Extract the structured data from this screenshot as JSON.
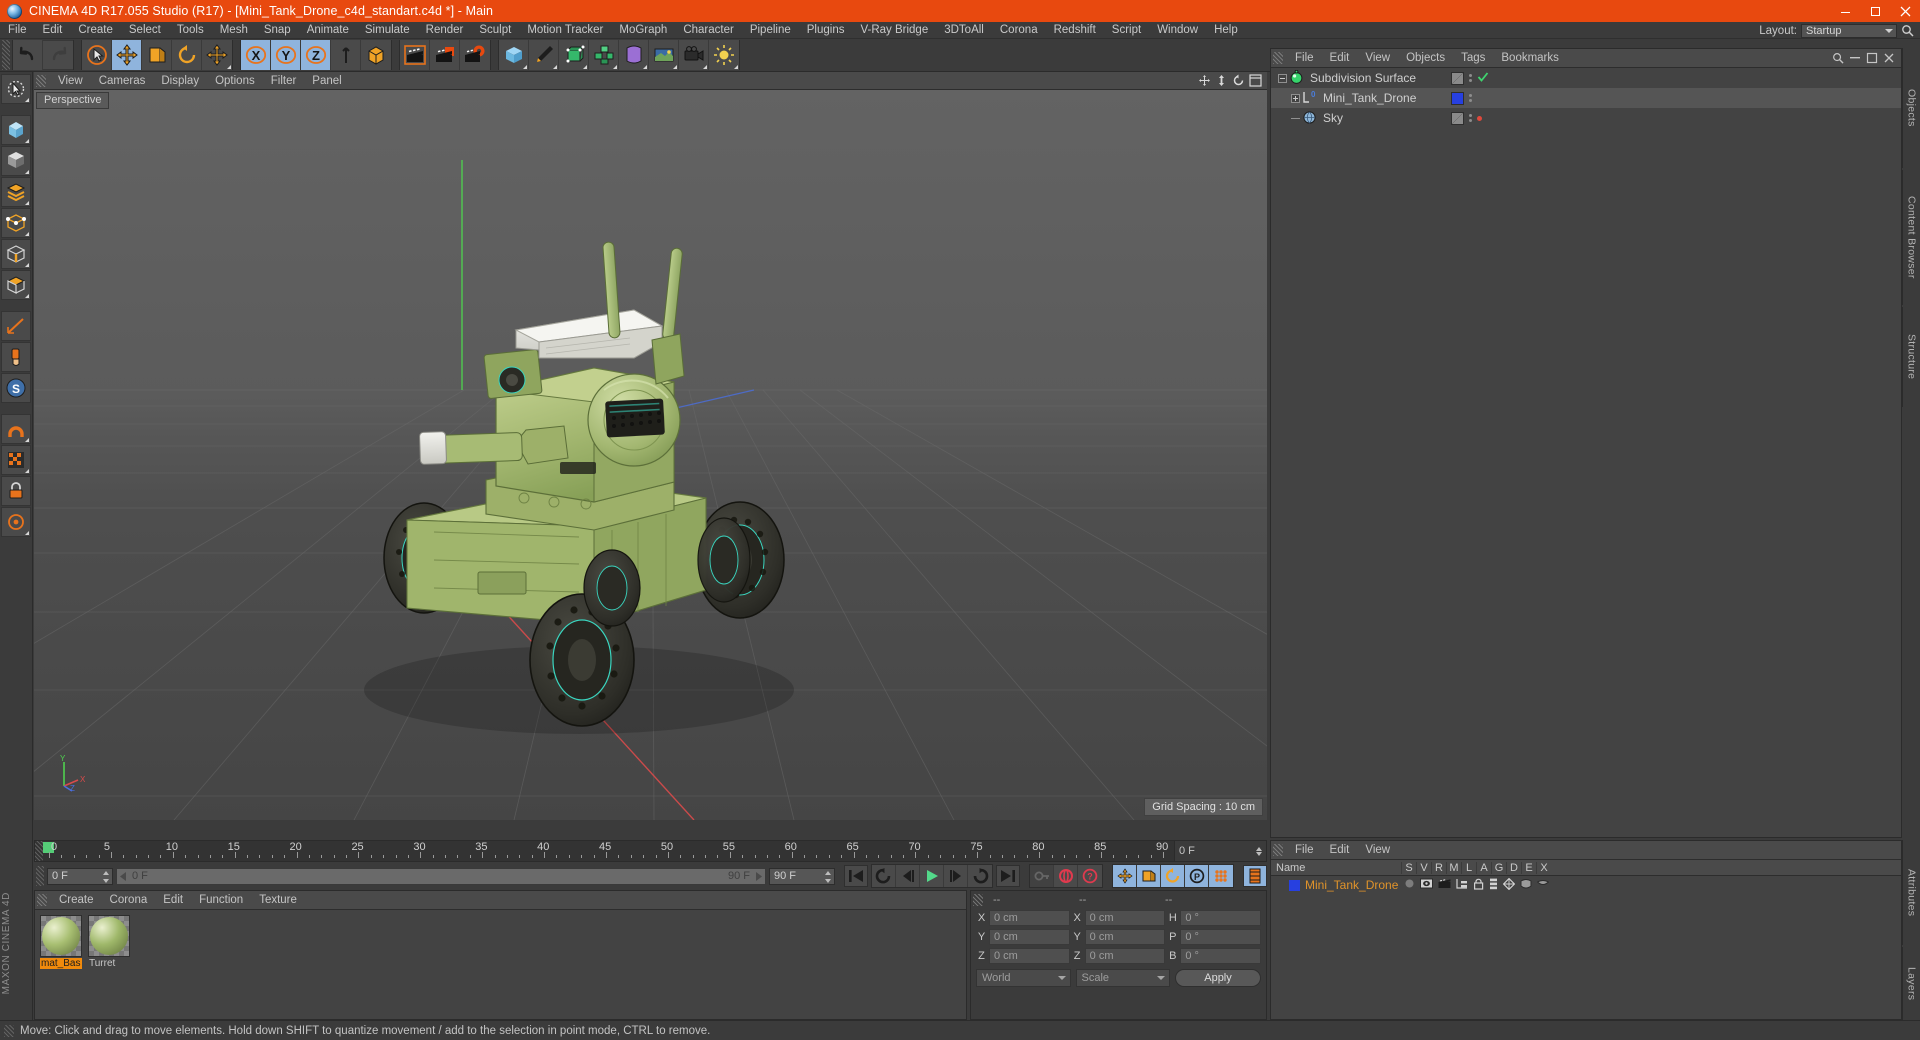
{
  "window": {
    "title": "CINEMA 4D R17.055 Studio (R17) - [Mini_Tank_Drone_c4d_standart.c4d *] - Main",
    "app_icon": "c4d-logo-icon",
    "minimize": "–",
    "maximize": "☐",
    "close": "✕",
    "titlebar_color": "#e8490f"
  },
  "menubar": {
    "items": [
      "File",
      "Edit",
      "Create",
      "Select",
      "Tools",
      "Mesh",
      "Snap",
      "Animate",
      "Simulate",
      "Render",
      "Sculpt",
      "Motion Tracker",
      "MoGraph",
      "Character",
      "Pipeline",
      "Plugins",
      "V-Ray Bridge",
      "3DToAll",
      "Corona",
      "Redshift",
      "Script",
      "Window",
      "Help"
    ],
    "layout_label": "Layout:",
    "layout_value": "Startup",
    "search_icon": "search-icon"
  },
  "toolbar": {
    "groups": [
      {
        "name": "history",
        "buttons": [
          {
            "icon": "undo-icon",
            "state": "normal"
          },
          {
            "icon": "redo-icon",
            "state": "disabled"
          }
        ]
      },
      {
        "name": "transform",
        "buttons": [
          {
            "icon": "select-cursor-icon",
            "state": "normal"
          },
          {
            "icon": "move-tool-icon",
            "state": "active"
          },
          {
            "icon": "scale-tool-icon",
            "state": "normal"
          },
          {
            "icon": "rotate-tool-icon",
            "state": "normal"
          },
          {
            "icon": "move-alt-icon",
            "state": "normal"
          }
        ]
      },
      {
        "name": "axis-locks",
        "buttons": [
          {
            "icon": "axis-x-icon",
            "state": "active"
          },
          {
            "icon": "axis-y-icon",
            "state": "active"
          },
          {
            "icon": "axis-z-icon",
            "state": "active"
          },
          {
            "icon": "world-axis-icon",
            "state": "normal"
          },
          {
            "icon": "object-axis-icon",
            "state": "normal"
          }
        ]
      },
      {
        "name": "render",
        "buttons": [
          {
            "icon": "render-view-icon",
            "state": "normal"
          },
          {
            "icon": "render-to-picture-icon",
            "state": "normal"
          },
          {
            "icon": "render-settings-icon",
            "state": "normal"
          }
        ]
      },
      {
        "name": "create",
        "buttons": [
          {
            "icon": "cube-primitive-icon",
            "state": "normal"
          },
          {
            "icon": "spline-pen-icon",
            "state": "normal"
          },
          {
            "icon": "generator-nurbs-icon",
            "state": "normal"
          },
          {
            "icon": "array-icon",
            "state": "normal"
          },
          {
            "icon": "deformer-icon",
            "state": "normal"
          },
          {
            "icon": "scene-environment-icon",
            "state": "normal"
          },
          {
            "icon": "camera-icon",
            "state": "normal"
          },
          {
            "icon": "light-icon",
            "state": "normal"
          }
        ]
      }
    ]
  },
  "left_palette": {
    "buttons": [
      {
        "icon": "live-selection-icon"
      },
      {
        "icon": "box-model-icon"
      },
      {
        "icon": "polygon-checker-icon"
      },
      {
        "icon": "layers-stack-icon"
      },
      {
        "icon": "points-mode-icon"
      },
      {
        "icon": "edges-mode-icon"
      },
      {
        "icon": "polygons-mode-icon"
      },
      {
        "icon": "measure-icon"
      },
      {
        "icon": "paint-brush-icon"
      },
      {
        "icon": "script-s-icon"
      },
      {
        "icon": "magnet-icon"
      },
      {
        "icon": "texture-grid-icon"
      },
      {
        "icon": "lock-icon"
      },
      {
        "icon": "snap-target-icon"
      }
    ],
    "brand": "MAXON\nCINEMA 4D"
  },
  "viewport": {
    "menu_items": [
      "View",
      "Cameras",
      "Display",
      "Options",
      "Filter",
      "Panel"
    ],
    "view_label": "Perspective",
    "grid_spacing": "Grid Spacing : 10 cm",
    "nav_icons": [
      "pan-icon",
      "dolly-icon",
      "rotate-view-icon",
      "maximize-view-icon"
    ],
    "axis_labels": [
      "Y",
      "Z",
      "X"
    ],
    "model": "mini-tank-drone-3d-model"
  },
  "object_manager": {
    "menu_items": [
      "File",
      "Edit",
      "View",
      "Objects",
      "Tags",
      "Bookmarks"
    ],
    "rows": [
      {
        "name": "Subdivision Surface",
        "icon": "subdivision-surface-icon",
        "expander": "minus",
        "indent": 0,
        "tag": "checkmark"
      },
      {
        "name": "Mini_Tank_Drone",
        "icon": "null-object-icon",
        "expander": "plus",
        "indent": 1,
        "tag": "blue-layer"
      },
      {
        "name": "Sky",
        "icon": "sky-object-icon",
        "expander": "none",
        "indent": 1,
        "tag": "red-dot"
      }
    ]
  },
  "timeline": {
    "ticks": [
      0,
      5,
      10,
      15,
      20,
      25,
      30,
      35,
      40,
      45,
      50,
      55,
      60,
      65,
      70,
      75,
      80,
      85,
      90
    ],
    "current_frame": "0 F",
    "end_frame": "90 F",
    "range_start_value": "0 F",
    "range_end_value": "90 F",
    "preview_start": "0 F",
    "preview_end": "90 F",
    "transport": [
      {
        "icon": "go-to-start-icon"
      },
      {
        "icon": "previous-key-icon"
      },
      {
        "icon": "step-back-icon"
      },
      {
        "icon": "play-icon"
      },
      {
        "icon": "step-forward-icon"
      },
      {
        "icon": "next-key-icon"
      },
      {
        "icon": "go-to-end-icon"
      }
    ],
    "record_tools": [
      {
        "icon": "autokey-icon",
        "state": "disabled"
      },
      {
        "icon": "record-active-objects-icon",
        "state": "normal"
      },
      {
        "icon": "autokeying-icon",
        "state": "normal"
      }
    ],
    "key_filters": [
      {
        "icon": "key-position-icon",
        "state": "active"
      },
      {
        "icon": "key-scale-icon",
        "state": "active"
      },
      {
        "icon": "key-rotation-icon",
        "state": "active"
      },
      {
        "icon": "key-param-icon",
        "state": "active"
      },
      {
        "icon": "key-pla-icon",
        "state": "active"
      },
      {
        "icon": "timeline-view-icon",
        "state": "active"
      }
    ]
  },
  "material_manager": {
    "menu_items": [
      "Create",
      "Corona",
      "Edit",
      "Function",
      "Texture"
    ],
    "materials": [
      {
        "name": "mat_Bas",
        "selected": true,
        "color": "#a8bf72"
      },
      {
        "name": "Turret",
        "selected": false,
        "color": "#9fb86a"
      }
    ]
  },
  "coordinates": {
    "headers": [
      "--",
      "--",
      "--"
    ],
    "rows": [
      {
        "label1": "X",
        "value1": "0 cm",
        "label2": "X",
        "value2": "0 cm",
        "label3": "H",
        "value3": "0 °"
      },
      {
        "label1": "Y",
        "value1": "0 cm",
        "label2": "Y",
        "value2": "0 cm",
        "label3": "P",
        "value3": "0 °"
      },
      {
        "label1": "Z",
        "value1": "0 cm",
        "label2": "Z",
        "value2": "0 cm",
        "label3": "B",
        "value3": "0 °"
      }
    ],
    "system": "World",
    "mode": "Scale",
    "apply": "Apply"
  },
  "layer_manager": {
    "menu_items": [
      "File",
      "Edit",
      "View"
    ],
    "columns": [
      "Name",
      "S",
      "V",
      "R",
      "M",
      "L",
      "A",
      "G",
      "D",
      "E",
      "X"
    ],
    "rows": [
      {
        "name": "Mini_Tank_Drone",
        "color": "#2740e0"
      }
    ]
  },
  "right_strips": [
    "Objects",
    "Content Browser",
    "Structure",
    "Attributes",
    "Layers"
  ],
  "statusbar": {
    "message": "Move: Click and drag to move elements. Hold down SHIFT to quantize movement / add to the selection in point mode, CTRL to remove."
  }
}
